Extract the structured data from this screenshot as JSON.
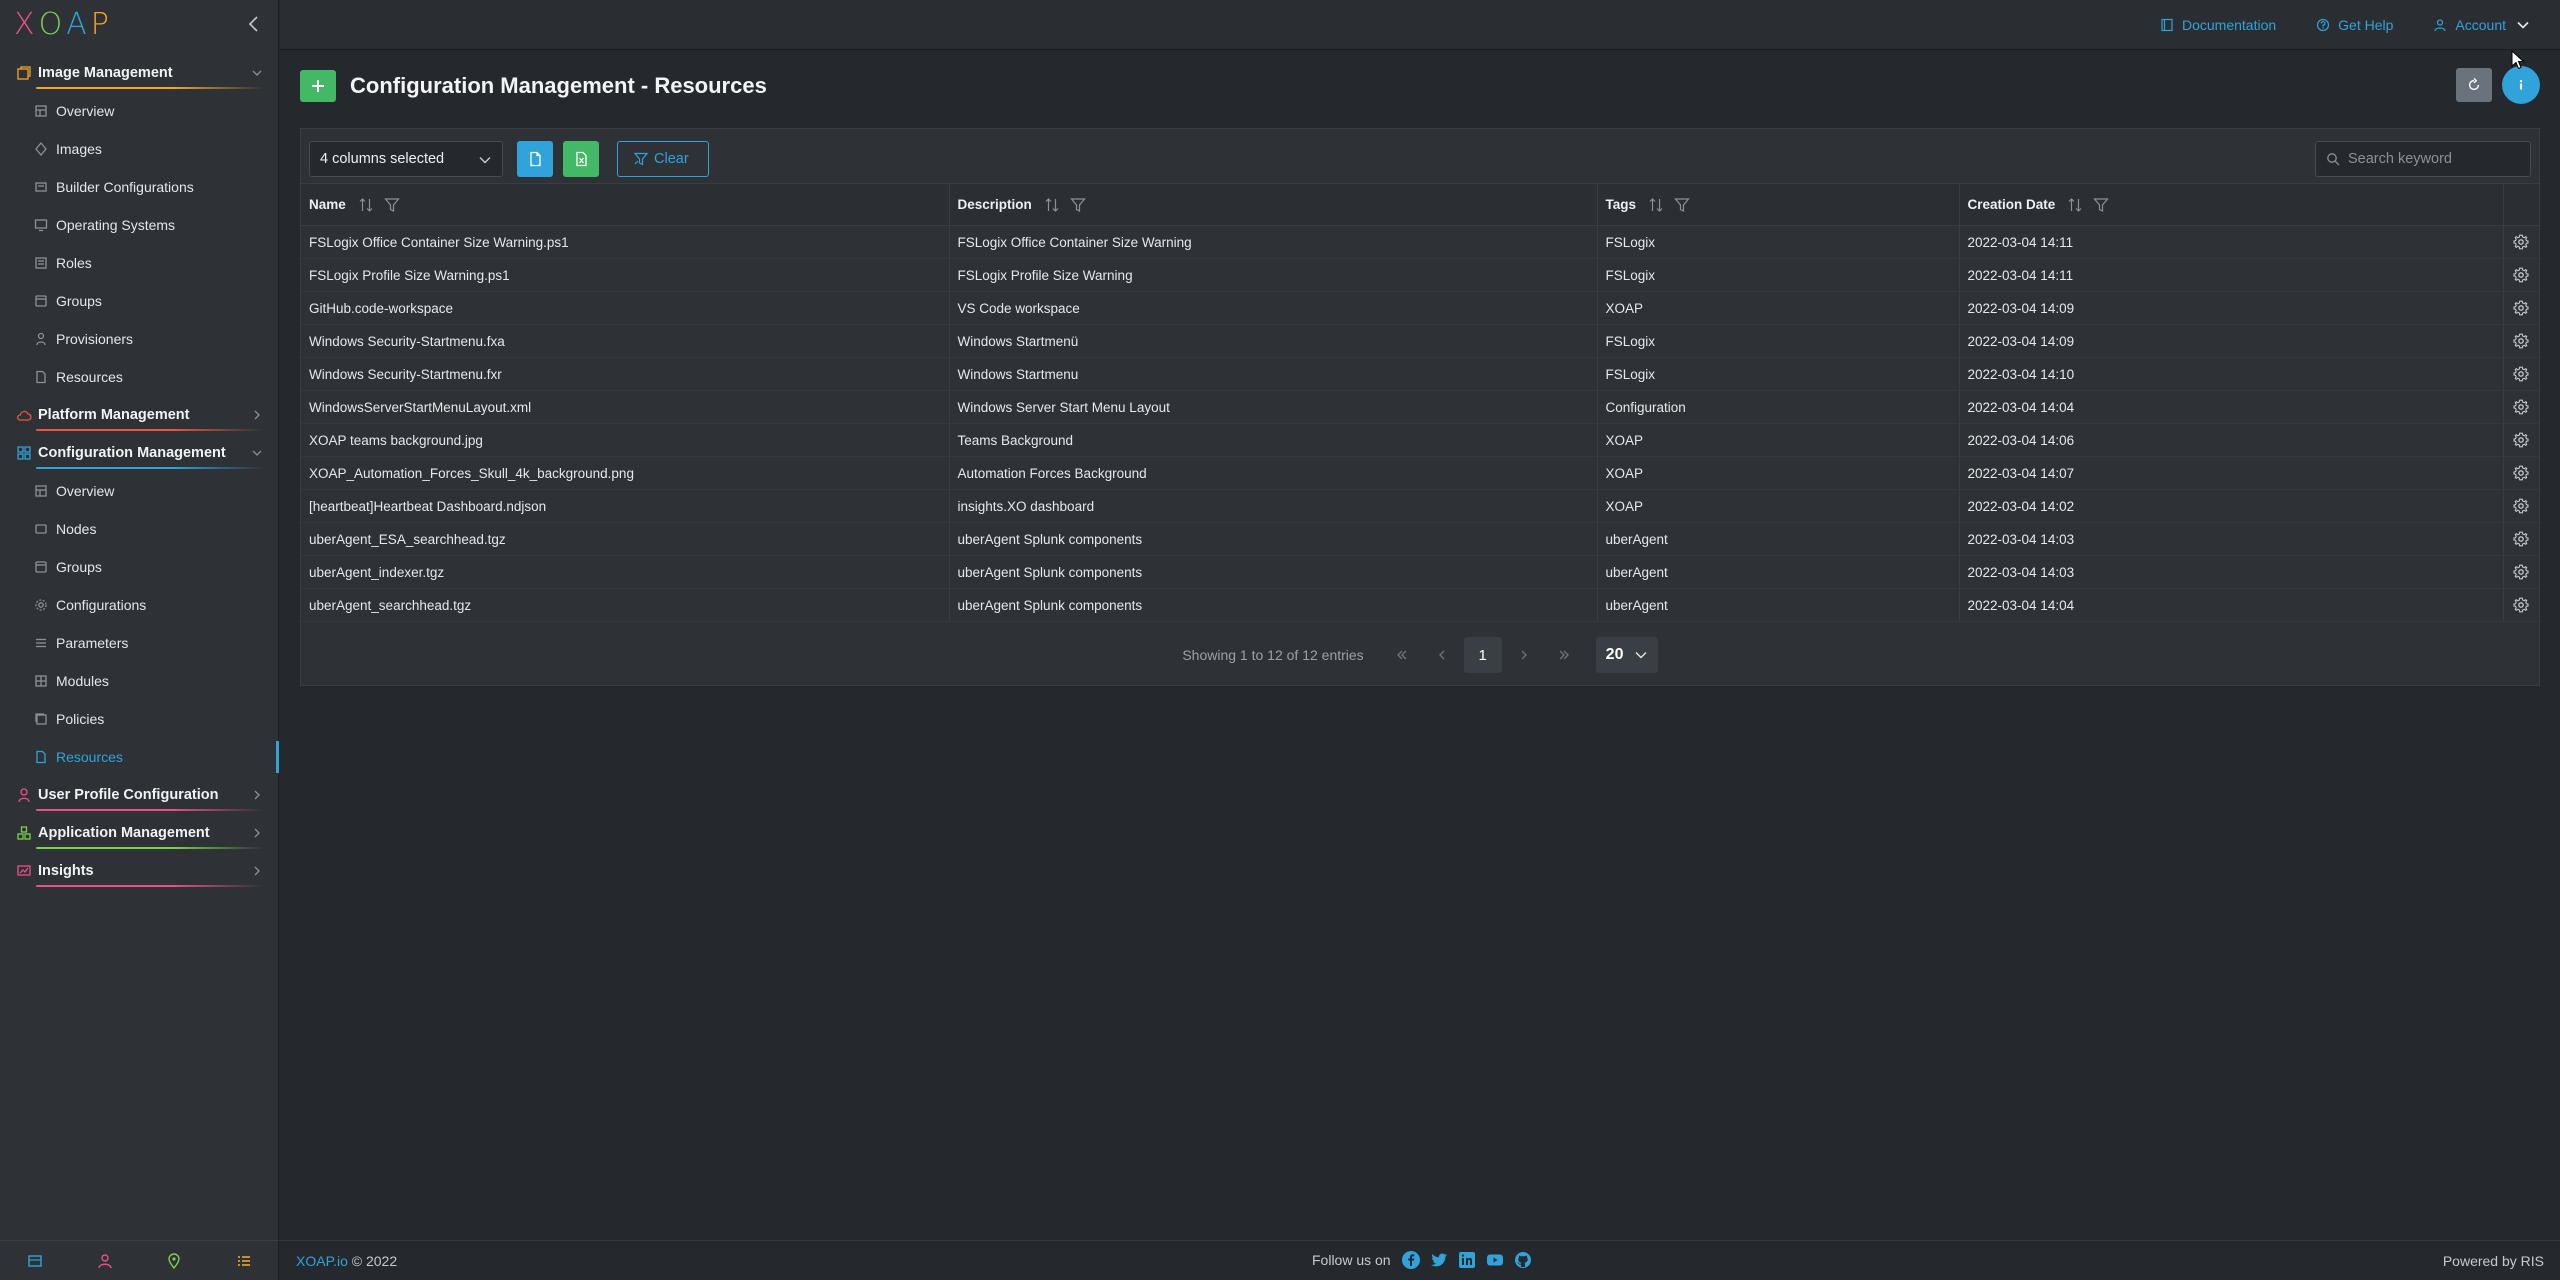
{
  "logo": {
    "letters": [
      "X",
      "O",
      "A",
      "P"
    ],
    "colors": [
      "#e94f8a",
      "#7bd14d",
      "#2fa3da",
      "#f5a623"
    ]
  },
  "sidebar": {
    "sections": [
      {
        "label": "Image Management",
        "icon": "image-stack-icon",
        "color": "#f5a623",
        "expanded": true,
        "items": [
          {
            "label": "Overview",
            "icon": "overview-icon"
          },
          {
            "label": "Images",
            "icon": "image-icon"
          },
          {
            "label": "Builder Configurations",
            "icon": "builder-icon"
          },
          {
            "label": "Operating Systems",
            "icon": "os-icon"
          },
          {
            "label": "Roles",
            "icon": "roles-icon"
          },
          {
            "label": "Groups",
            "icon": "groups-icon"
          },
          {
            "label": "Provisioners",
            "icon": "provisioner-icon"
          },
          {
            "label": "Resources",
            "icon": "resources-icon"
          }
        ]
      },
      {
        "label": "Platform Management",
        "icon": "cloud-icon",
        "color": "#e9573f",
        "expanded": false,
        "items": []
      },
      {
        "label": "Configuration Management",
        "icon": "grid-icon",
        "color": "#2fa3da",
        "expanded": true,
        "items": [
          {
            "label": "Overview",
            "icon": "overview-icon"
          },
          {
            "label": "Nodes",
            "icon": "nodes-icon"
          },
          {
            "label": "Groups",
            "icon": "groups-icon"
          },
          {
            "label": "Configurations",
            "icon": "gear-icon"
          },
          {
            "label": "Parameters",
            "icon": "list-icon"
          },
          {
            "label": "Modules",
            "icon": "modules-icon"
          },
          {
            "label": "Policies",
            "icon": "policies-icon"
          },
          {
            "label": "Resources",
            "icon": "resources-icon",
            "active": true
          }
        ]
      },
      {
        "label": "User Profile Configuration",
        "icon": "user-icon",
        "color": "#e94f8a",
        "expanded": false,
        "items": []
      },
      {
        "label": "Application Management",
        "icon": "apps-icon",
        "color": "#7bd14d",
        "expanded": false,
        "items": []
      },
      {
        "label": "Insights",
        "icon": "insights-icon",
        "color": "#e94f8a",
        "expanded": false,
        "items": []
      }
    ]
  },
  "topbar": {
    "links": [
      {
        "label": "Documentation",
        "icon": "book-icon"
      },
      {
        "label": "Get Help",
        "icon": "help-chat-icon"
      },
      {
        "label": "Account",
        "icon": "user-icon"
      }
    ]
  },
  "page": {
    "title": "Configuration Management - Resources"
  },
  "toolbar": {
    "columns_selected": "4 columns selected",
    "clear_label": "Clear",
    "search_placeholder": "Search keyword"
  },
  "table": {
    "columns": [
      "Name",
      "Description",
      "Tags",
      "Creation Date"
    ],
    "rows": [
      [
        "FSLogix Office Container Size Warning.ps1",
        "FSLogix Office Container Size Warning",
        "FSLogix",
        "2022-03-04 14:11"
      ],
      [
        "FSLogix Profile Size Warning.ps1",
        "FSLogix Profile Size Warning",
        "FSLogix",
        "2022-03-04 14:11"
      ],
      [
        "GitHub.code-workspace",
        "VS Code workspace",
        "XOAP",
        "2022-03-04 14:09"
      ],
      [
        "Windows Security-Startmenu.fxa",
        "Windows Startmenü",
        "FSLogix",
        "2022-03-04 14:09"
      ],
      [
        "Windows Security-Startmenu.fxr",
        "Windows Startmenu",
        "FSLogix",
        "2022-03-04 14:10"
      ],
      [
        "WindowsServerStartMenuLayout.xml",
        "Windows Server Start Menu Layout",
        "Configuration",
        "2022-03-04 14:04"
      ],
      [
        "XOAP teams background.jpg",
        "Teams Background",
        "XOAP",
        "2022-03-04 14:06"
      ],
      [
        "XOAP_Automation_Forces_Skull_4k_background.png",
        "Automation Forces Background",
        "XOAP",
        "2022-03-04 14:07"
      ],
      [
        "[heartbeat]Heartbeat Dashboard.ndjson",
        "insights.XO dashboard",
        "XOAP",
        "2022-03-04 14:02"
      ],
      [
        "uberAgent_ESA_searchhead.tgz",
        "uberAgent Splunk components",
        "uberAgent",
        "2022-03-04 14:03"
      ],
      [
        "uberAgent_indexer.tgz",
        "uberAgent Splunk components",
        "uberAgent",
        "2022-03-04 14:03"
      ],
      [
        "uberAgent_searchhead.tgz",
        "uberAgent Splunk components",
        "uberAgent",
        "2022-03-04 14:04"
      ]
    ]
  },
  "pager": {
    "info": "Showing 1 to 12 of 12 entries",
    "current": "1",
    "page_size": "20"
  },
  "footer": {
    "brand": "XOAP.io",
    "copyright": " © 2022",
    "follow": "Follow us on",
    "powered": "Powered by RIS"
  },
  "colors": {
    "accent": "#2fa3da",
    "success": "#43b866",
    "bg": "#25292e",
    "panel": "#2e3237"
  }
}
